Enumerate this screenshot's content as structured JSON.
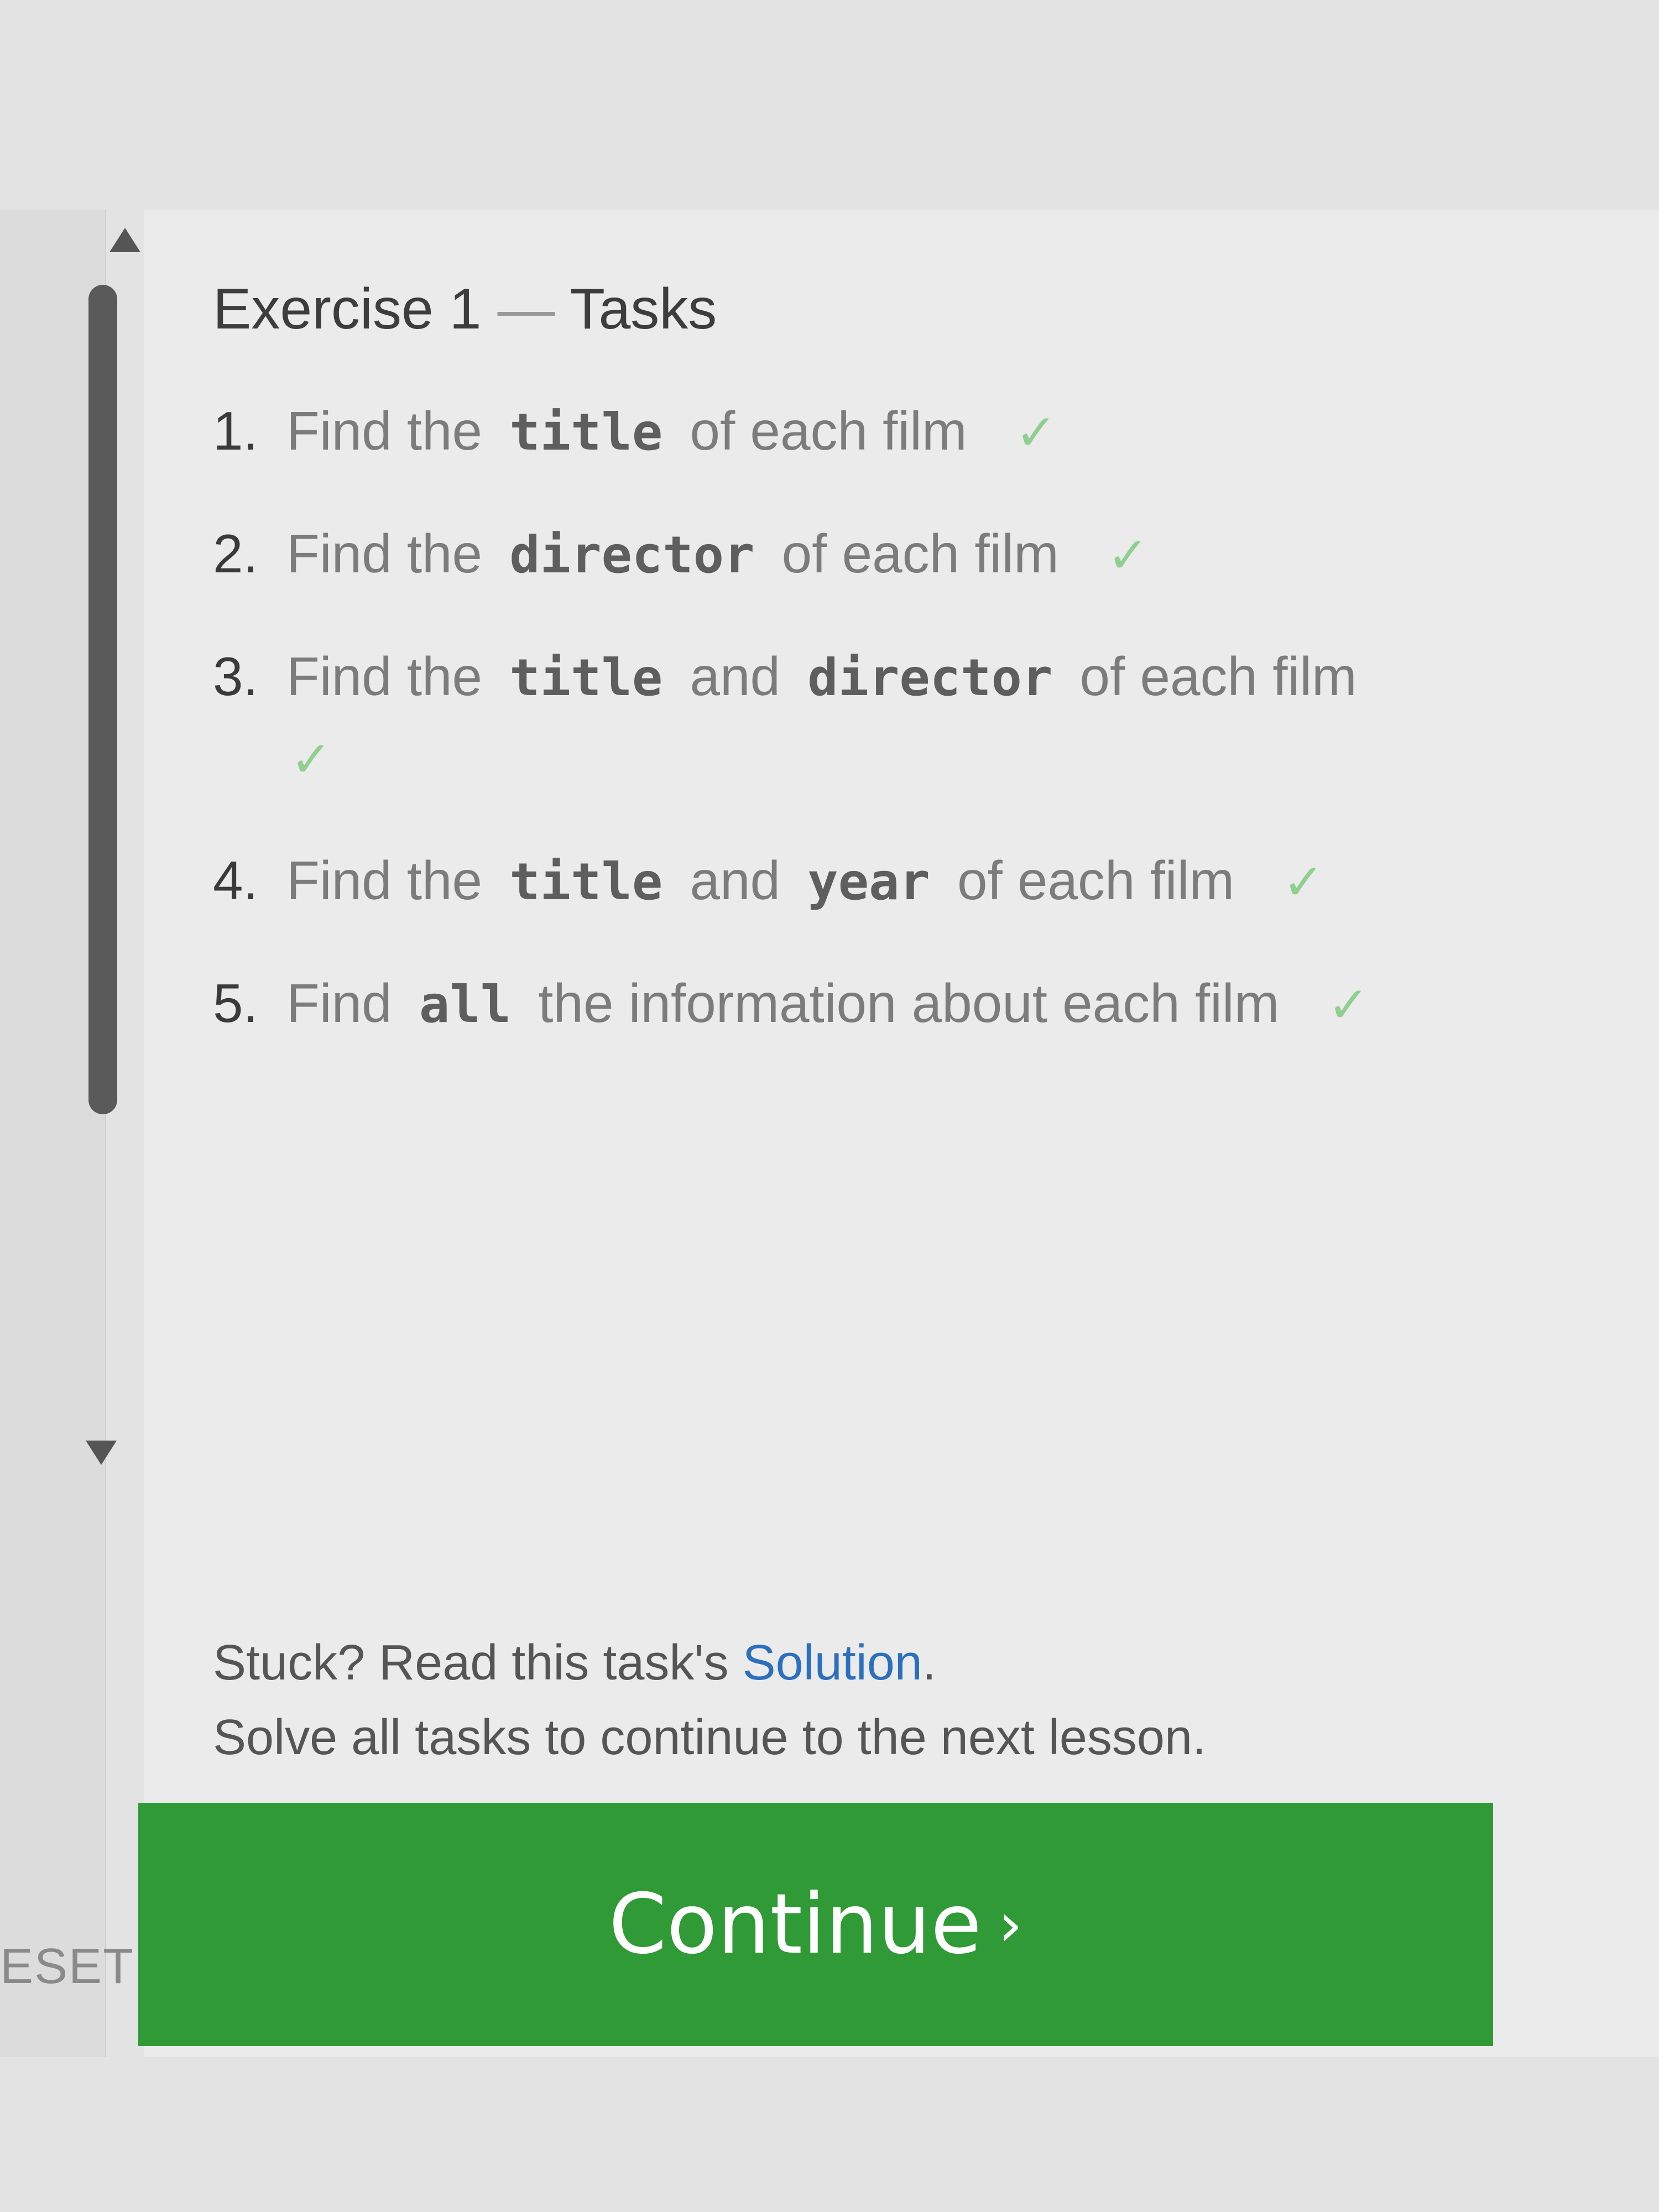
{
  "panel": {
    "title_left": "Exercise 1",
    "title_dash": "—",
    "title_right": "Tasks"
  },
  "tasks": [
    {
      "num": "1.",
      "pre": "Find the",
      "code1": "title",
      "mid": "",
      "code2": "",
      "post": "of each film",
      "check": "✓"
    },
    {
      "num": "2.",
      "pre": "Find the",
      "code1": "director",
      "mid": "",
      "code2": "",
      "post": "of each film",
      "check": "✓"
    },
    {
      "num": "3.",
      "pre": "Find the",
      "code1": "title",
      "mid": "and",
      "code2": "director",
      "post": "of each film",
      "check": "✓"
    },
    {
      "num": "4.",
      "pre": "Find the",
      "code1": "title",
      "mid": "and",
      "code2": "year",
      "post": "of each film",
      "check": "✓"
    },
    {
      "num": "5.",
      "pre": "Find",
      "code1": "all",
      "mid": "",
      "code2": "",
      "post": "the information about each film",
      "check": "✓"
    }
  ],
  "hint": {
    "stuck_prefix": "Stuck? Read this task's",
    "solution_link": "Solution",
    "stuck_suffix": ".",
    "solve_all": "Solve all tasks to continue to the next lesson."
  },
  "continue_button": {
    "label": "Continue",
    "chevron": "›"
  },
  "left_gutter": {
    "reset_label": "ESET"
  },
  "colors": {
    "accent_green": "#2f9a36",
    "check_green": "#8fcf8f",
    "link_blue": "#2c6fbd"
  }
}
